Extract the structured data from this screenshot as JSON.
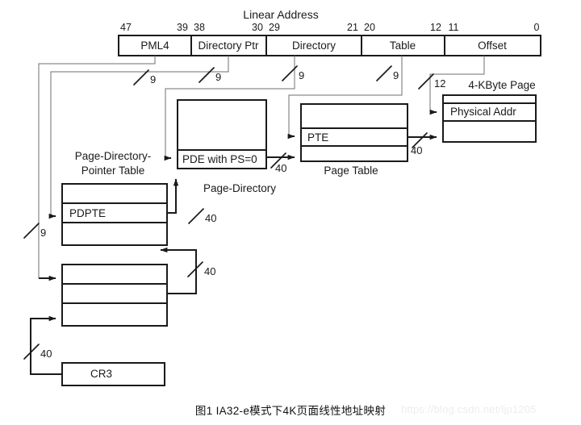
{
  "diagram": {
    "title": "Linear Address",
    "caption": "图1  IA32-e模式下4K页面线性地址映射",
    "watermark": "https://blog.csdn.net/ljp1205",
    "linear_address": {
      "bit_labels": [
        "47",
        "39",
        "38",
        "30",
        "29",
        "21",
        "20",
        "12",
        "11",
        "0"
      ],
      "fields": [
        {
          "name": "PML4",
          "high_bit": "47",
          "low_bit": "39",
          "width": "9"
        },
        {
          "name": "Directory Ptr",
          "high_bit": "38",
          "low_bit": "30",
          "width": "9"
        },
        {
          "name": "Directory",
          "high_bit": "29",
          "low_bit": "21",
          "width": "9"
        },
        {
          "name": "Table",
          "high_bit": "20",
          "low_bit": "12",
          "width": "9"
        },
        {
          "name": "Offset",
          "high_bit": "11",
          "low_bit": "0",
          "width": "12"
        }
      ]
    },
    "structures": [
      {
        "id": "page-directory-pointer-table",
        "caption": "Page-Directory-",
        "caption_line2": "Pointer Table",
        "entry": "PDPTE"
      },
      {
        "id": "page-directory",
        "caption": "Page-Directory",
        "entry": "PDE with PS=0"
      },
      {
        "id": "page-table",
        "caption": "Page Table",
        "entry": "PTE"
      },
      {
        "id": "four-kbyte-page",
        "caption": "4-KByte Page",
        "entry": "Physical Addr"
      },
      {
        "id": "cr3-register",
        "entry": "CR3"
      }
    ],
    "bus_widths": {
      "pml4_index": "9",
      "dir_ptr_index": "9",
      "directory_index": "9",
      "table_index": "9",
      "offset": "12",
      "cr3_to_pml4": "40",
      "pml4e_to_pdpt": "40",
      "pdpte_to_pd": "40",
      "pde_to_pt": "40",
      "pte_to_page": "40"
    },
    "colors": {
      "stroke": "#1a1a1a",
      "thin_stroke": "#6f6f6f",
      "background": "#ffffff",
      "watermark": "#ededed"
    }
  }
}
